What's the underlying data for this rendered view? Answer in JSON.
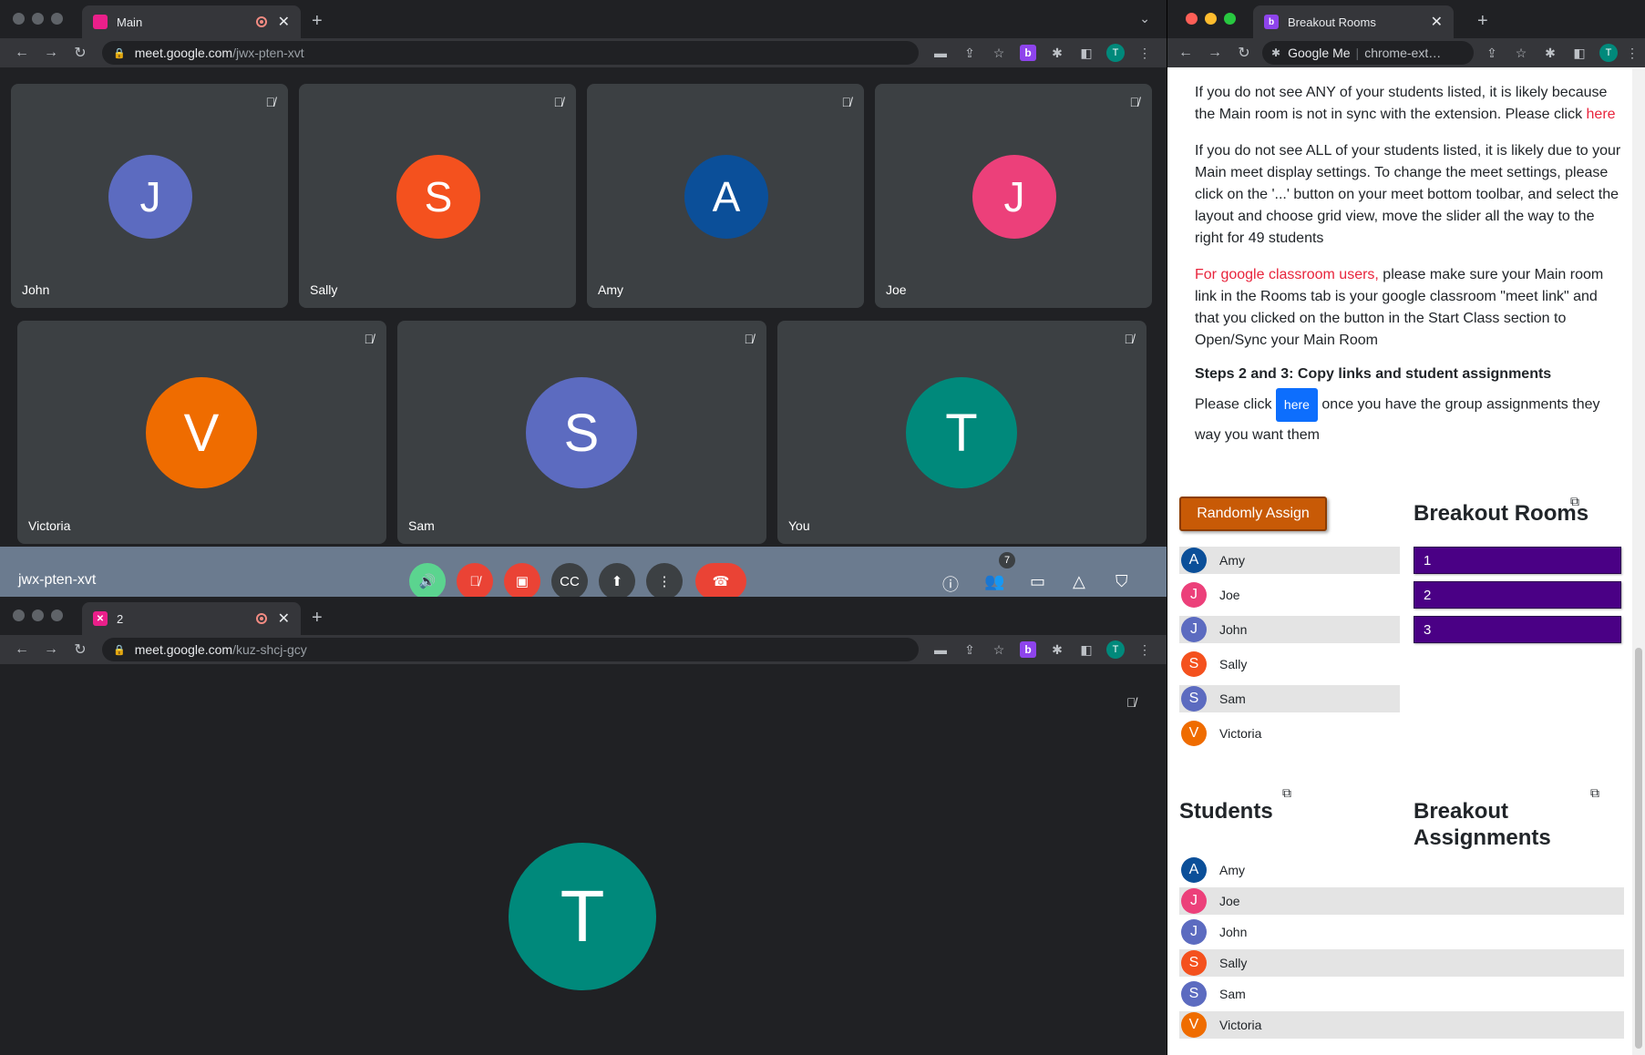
{
  "main_window": {
    "tab_title": "Main",
    "url_host": "meet.google.com",
    "url_path": "/jwx-pten-xvt",
    "participants": [
      {
        "name": "John",
        "initial": "J",
        "color": "#5c6bc0"
      },
      {
        "name": "Sally",
        "initial": "S",
        "color": "#f4511e"
      },
      {
        "name": "Amy",
        "initial": "A",
        "color": "#0b4f99"
      },
      {
        "name": "Joe",
        "initial": "J",
        "color": "#ec407a"
      },
      {
        "name": "Victoria",
        "initial": "V",
        "color": "#ef6c00"
      },
      {
        "name": "Sam",
        "initial": "S",
        "color": "#5c6bc0"
      },
      {
        "name": "You",
        "initial": "T",
        "color": "#00897b"
      }
    ],
    "meeting_code": "jwx-pten-xvt",
    "people_count": "7",
    "profile_initial": "T",
    "ext_icon_label": "b"
  },
  "second_window": {
    "tab_title": "2",
    "url_host": "meet.google.com",
    "url_path": "/kuz-shcj-gcy",
    "participant": {
      "initial": "T",
      "color": "#00897b"
    },
    "profile_initial": "T",
    "ext_icon_label": "b"
  },
  "ext_window": {
    "tab_title": "Breakout Rooms",
    "tab_icon": "b",
    "url_text": "Google Me",
    "url_ext": "chrome-ext…",
    "profile_initial": "T",
    "para1_a": "If you do not see ANY of your students listed, it is likely because the Main room is not in sync with the extension. Please click ",
    "para1_link": "here",
    "para2": "If you do not see ALL of your students listed, it is likely due to your Main meet display settings. To change the meet settings, please click on the '...' button on your meet bottom toolbar, and select the layout and choose grid view, move the slider all the way to the right for 49 students",
    "para3_red": "For google classroom users,",
    "para3_rest": " please make sure your Main room link in the Rooms tab is your google classroom \"meet link\" and that you clicked on the button in the Start Class section to Open/Sync your Main Room",
    "steps_heading": "Steps 2 and 3: Copy links and student assignments",
    "para4_a": "Please click ",
    "para4_btn": "here",
    "para4_b": " once you have the group assignments they way you want them",
    "randomly_assign": "Randomly Assign",
    "breakout_rooms_heading": "Breakout Rooms",
    "roster": [
      {
        "name": "Amy",
        "initial": "A",
        "color": "#0b4f99"
      },
      {
        "name": "Joe",
        "initial": "J",
        "color": "#ec407a"
      },
      {
        "name": "John",
        "initial": "J",
        "color": "#5c6bc0"
      },
      {
        "name": "Sally",
        "initial": "S",
        "color": "#f4511e"
      },
      {
        "name": "Sam",
        "initial": "S",
        "color": "#5c6bc0"
      },
      {
        "name": "Victoria",
        "initial": "V",
        "color": "#ef6c00"
      }
    ],
    "rooms": [
      "1",
      "2",
      "3"
    ],
    "students_heading": "Students",
    "assignments_heading_1": "Breakout",
    "assignments_heading_2": "Assignments"
  },
  "icons": {
    "mic_off": "mic-off-icon",
    "copy": "copy-icon"
  }
}
